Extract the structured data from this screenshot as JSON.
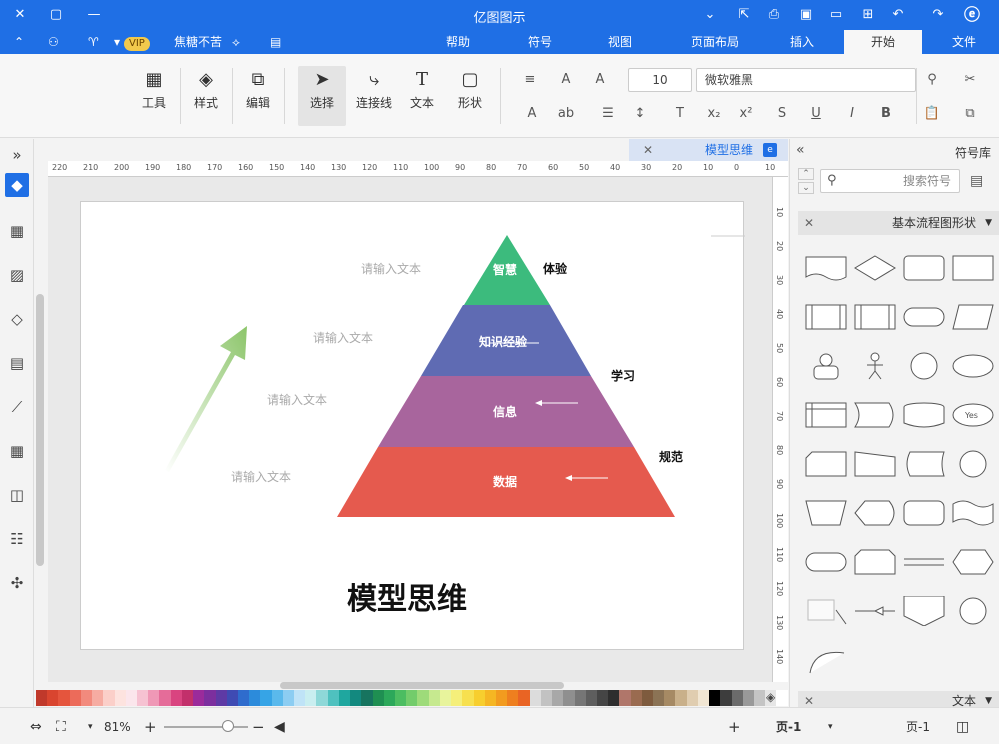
{
  "titlebar": {
    "title": "亿图图示"
  },
  "menu": {
    "tabs": [
      "文件",
      "开始",
      "插入",
      "页面布局",
      "视图",
      "符号",
      "帮助"
    ],
    "active_tab": "开始",
    "user": "焦糖不苦",
    "vip": "VIP"
  },
  "ribbon": {
    "font_name": "微软雅黑",
    "font_size": "10",
    "tools": {
      "shape": "形状",
      "text": "文本",
      "connector": "连接线",
      "select": "选择",
      "edit": "编辑",
      "style": "样式",
      "tools": "工具"
    }
  },
  "document": {
    "tab_name": "模型思维"
  },
  "ruler": {
    "h_ticks": [
      "220",
      "210",
      "200",
      "190",
      "180",
      "170",
      "160",
      "150",
      "140",
      "130",
      "120",
      "110",
      "100",
      "90",
      "80",
      "70",
      "60",
      "50",
      "40",
      "30",
      "20",
      "10",
      "0",
      "10"
    ],
    "v_ticks": [
      "10",
      "20",
      "30",
      "40",
      "50",
      "60",
      "70",
      "80",
      "90",
      "100",
      "110",
      "120",
      "130",
      "140"
    ]
  },
  "diagram": {
    "title": "模型思维",
    "levels": [
      {
        "label": "智慧",
        "side": "体验",
        "color": "#3cbb7d"
      },
      {
        "label": "知识经验",
        "side": "学习",
        "color": "#5f6bb3"
      },
      {
        "label": "信息",
        "side": "",
        "color": "#a8659d"
      },
      {
        "label": "数据",
        "side": "规范",
        "color": "#e55a4e"
      }
    ],
    "placeholders": [
      "请输入文本",
      "请输入文本",
      "请输入文本",
      "请输入文本"
    ]
  },
  "right_panel": {
    "title": "符号库",
    "search_placeholder": "搜索符号",
    "section": "基本流程图形状",
    "section2": "文本"
  },
  "statusbar": {
    "page_name": "页-1",
    "page_tab": "页-1",
    "zoom": "81%"
  },
  "palette": [
    "#c0392b",
    "#d9452f",
    "#e5553d",
    "#ec6b5a",
    "#f28a7d",
    "#f6aca2",
    "#fbcfc9",
    "#fde3df",
    "#fbe6ec",
    "#f6c2d2",
    "#ef98b6",
    "#e56c99",
    "#d94480",
    "#c2306b",
    "#9b2b9b",
    "#7c2f9e",
    "#5e3aa5",
    "#3f4bb3",
    "#2f6ccd",
    "#2c8bdb",
    "#36a4e6",
    "#5ab9ec",
    "#8ccdf2",
    "#bfe3f7",
    "#c9eef0",
    "#8ed8d8",
    "#4fc1bf",
    "#1fa79f",
    "#13897f",
    "#17745f",
    "#1f8f52",
    "#2ca85a",
    "#4cbd61",
    "#73cc6b",
    "#9edb7a",
    "#c6e98f",
    "#e8f49c",
    "#f5ef7a",
    "#f7e04f",
    "#f7ce2e",
    "#f5b623",
    "#f29b1f",
    "#ee7f1f",
    "#e96424",
    "#dcdcdc",
    "#c2c2c2",
    "#a8a8a8",
    "#8f8f8f",
    "#767676",
    "#5e5e5e",
    "#454545",
    "#2e2e2e",
    "#b0766a",
    "#9a6b50",
    "#7e5b3e",
    "#8b7355",
    "#a68a64",
    "#c9b08a",
    "#e0cdb0",
    "#f1e6d3",
    "#000000",
    "#3d3d3d",
    "#6b6b6b",
    "#999999",
    "#c4c4c4",
    "#e6e6e6",
    "#ffffff"
  ]
}
